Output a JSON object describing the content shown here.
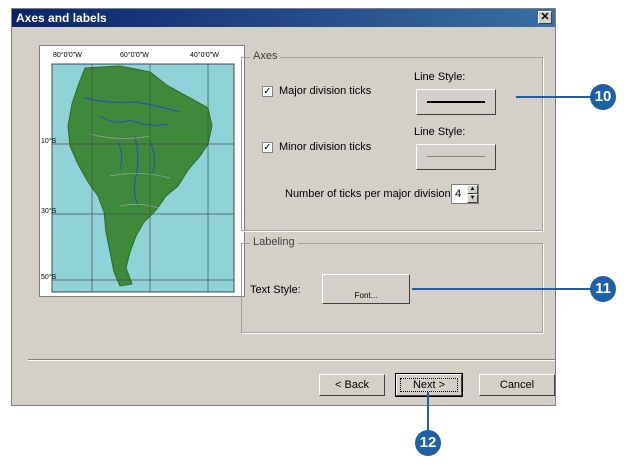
{
  "dialog": {
    "title": "Axes and labels"
  },
  "map": {
    "top_ticks": [
      "80°0'0\"W",
      "60°0'0\"W",
      "40°0'0\"W"
    ],
    "side_ticks": [
      "10°S",
      "30°S",
      "50°S"
    ],
    "colors": {
      "ocean": "#8fd2d8",
      "land": "#3f8a3a",
      "rivers": "#2c4fb5",
      "grid": "#4a4a4a"
    }
  },
  "axes": {
    "legend": "Axes",
    "major_ticks_label": "Major division ticks",
    "major_ticks_checked": true,
    "major_line_style_label": "Line Style:",
    "minor_ticks_label": "Minor division ticks",
    "minor_ticks_checked": true,
    "minor_line_style_label": "Line Style:",
    "ticks_per_major_label": "Number of ticks per major division:",
    "ticks_per_major_value": "4"
  },
  "labeling": {
    "legend": "Labeling",
    "text_style_label": "Text Style:",
    "font_button": "Font..."
  },
  "buttons": {
    "back": "< Back",
    "next": "Next >",
    "cancel": "Cancel"
  },
  "callouts": {
    "c10": "10",
    "c11": "11",
    "c12": "12",
    "color": "#2060a8"
  }
}
